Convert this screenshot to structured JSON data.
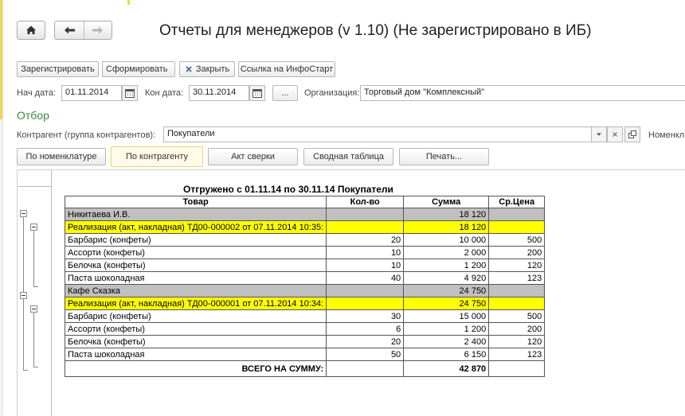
{
  "window": {
    "title": "Отчеты для менеджеров (v 1.10) (Не зарегистрировано в ИБ)"
  },
  "nav": {
    "home_icon": "house-icon",
    "back_icon": "arrow-left-icon",
    "forward_icon": "arrow-right-icon"
  },
  "toolbar": {
    "register_label": "Зарегистрировать",
    "generate_label": "Сформировать",
    "close_label": "Закрыть",
    "link_label": "Ссылка на ИнфоСтарт"
  },
  "params": {
    "start_label": "Нач дата:",
    "start_value": "01.11.2014",
    "end_label": "Кон дата:",
    "end_value": "30.11.2014",
    "period_button": "...",
    "org_label": "Организация:",
    "org_value": "Торговый дом \"Комплексный\""
  },
  "filter": {
    "section_title": "Отбор",
    "contractor_label": "Контрагент (группа контрагентов):",
    "contractor_value": "Покупатели",
    "nomenclature_label": "Номенкл"
  },
  "report_buttons": [
    "По номенклатуре",
    "По контрагенту",
    "Акт сверки",
    "Сводная таблица",
    "Печать..."
  ],
  "report": {
    "title": "Отгружено с 01.11.14 по 30.11.14 Покупатели",
    "headers": [
      "Товар",
      "Кол-во",
      "Сумма",
      "Ср.Цена"
    ],
    "rows": [
      {
        "type": "grey",
        "cells": [
          "Никитаева И.В.",
          "",
          "18 120",
          ""
        ]
      },
      {
        "type": "yellow",
        "cells": [
          "Реализация (акт, накладная) ТД00-000002 от 07.11.2014 10:35:",
          "",
          "18 120",
          ""
        ]
      },
      {
        "type": "item",
        "cells": [
          "Барбарис (конфеты)",
          "20",
          "10 000",
          "500"
        ]
      },
      {
        "type": "item",
        "cells": [
          "Ассорти (конфеты)",
          "10",
          "2 000",
          "200"
        ]
      },
      {
        "type": "item",
        "cells": [
          "Белочка (конфеты)",
          "10",
          "1 200",
          "120"
        ]
      },
      {
        "type": "item",
        "cells": [
          "Паста шоколадная",
          "40",
          "4 920",
          "123"
        ]
      },
      {
        "type": "grey",
        "cells": [
          "Кафе Сказка",
          "",
          "24 750",
          ""
        ]
      },
      {
        "type": "yellow",
        "cells": [
          "Реализация (акт, накладная) ТД00-000001 от 07.11.2014 10:34:",
          "",
          "24 750",
          ""
        ]
      },
      {
        "type": "item",
        "cells": [
          "Барбарис (конфеты)",
          "30",
          "15 000",
          "500"
        ]
      },
      {
        "type": "item",
        "cells": [
          "Ассорти (конфеты)",
          "6",
          "1 200",
          "200"
        ]
      },
      {
        "type": "item",
        "cells": [
          "Белочка (конфеты)",
          "20",
          "2 400",
          "120"
        ]
      },
      {
        "type": "item",
        "cells": [
          "Паста шоколадная",
          "50",
          "6 150",
          "123"
        ]
      }
    ],
    "total": {
      "label": "ВСЕГО НА СУММУ:",
      "value": "42 870"
    }
  },
  "colors": {
    "group_row": "#c0c0c0",
    "document_row": "#ffff00",
    "section_title": "#3c8b3c",
    "active_button_border": "#e8d468"
  }
}
